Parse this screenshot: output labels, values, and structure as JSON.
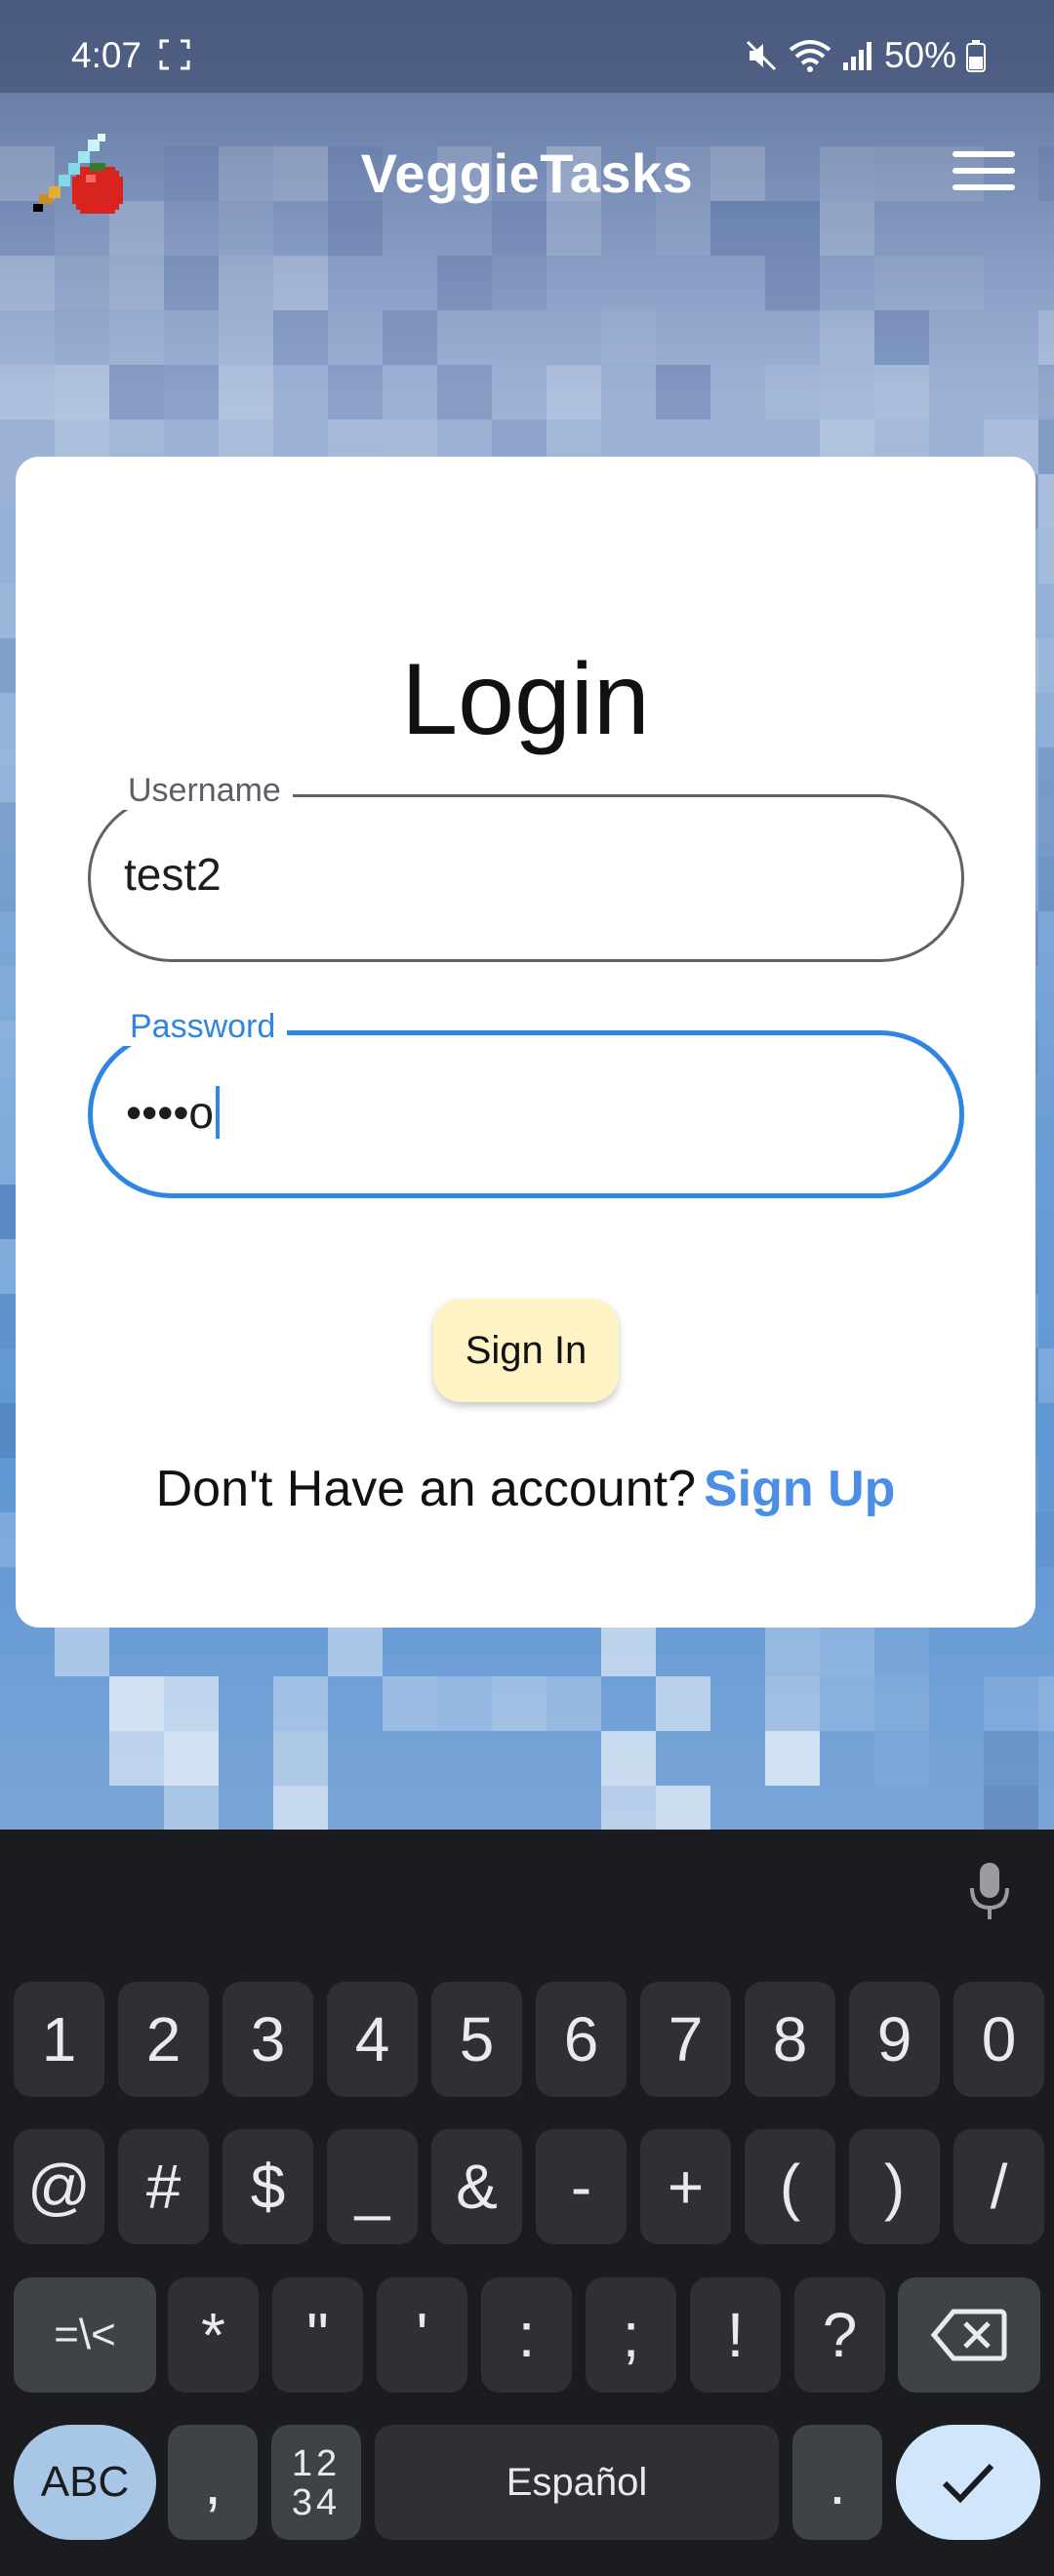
{
  "status_bar": {
    "time": "4:07",
    "battery": "50%",
    "icons": [
      "screenshot-icon",
      "mute-icon",
      "wifi-icon",
      "signal-icon",
      "battery-icon"
    ]
  },
  "app_bar": {
    "title": "VeggieTasks",
    "logo_icon": "tomato-sword-logo",
    "menu_icon": "hamburger-menu-icon"
  },
  "login": {
    "title": "Login",
    "username": {
      "label": "Username",
      "value": "test2"
    },
    "password": {
      "label": "Password",
      "value": "••••o"
    },
    "sign_in_label": "Sign In",
    "no_account_text": "Don't Have an account?",
    "sign_up_label": "Sign Up"
  },
  "keyboard": {
    "row1": [
      "1",
      "2",
      "3",
      "4",
      "5",
      "6",
      "7",
      "8",
      "9",
      "0"
    ],
    "row2": [
      "@",
      "#",
      "$",
      "_",
      "&",
      "-",
      "+",
      "(",
      ")",
      "/"
    ],
    "row3": [
      "=\\<",
      "*",
      "\"",
      "'",
      ":",
      ";",
      "!",
      "?"
    ],
    "abc_label": "ABC",
    "comma_label": ",",
    "num_label": "12\n34",
    "space_label": "Español",
    "period_label": ".",
    "icons": [
      "mic-icon",
      "backspace-icon",
      "enter-check-icon"
    ]
  },
  "colors": {
    "accent": "#2f86e0",
    "link": "#4a8ee6",
    "button_bg": "#fdf3c4",
    "keyboard_bg": "#1b1c1f"
  }
}
